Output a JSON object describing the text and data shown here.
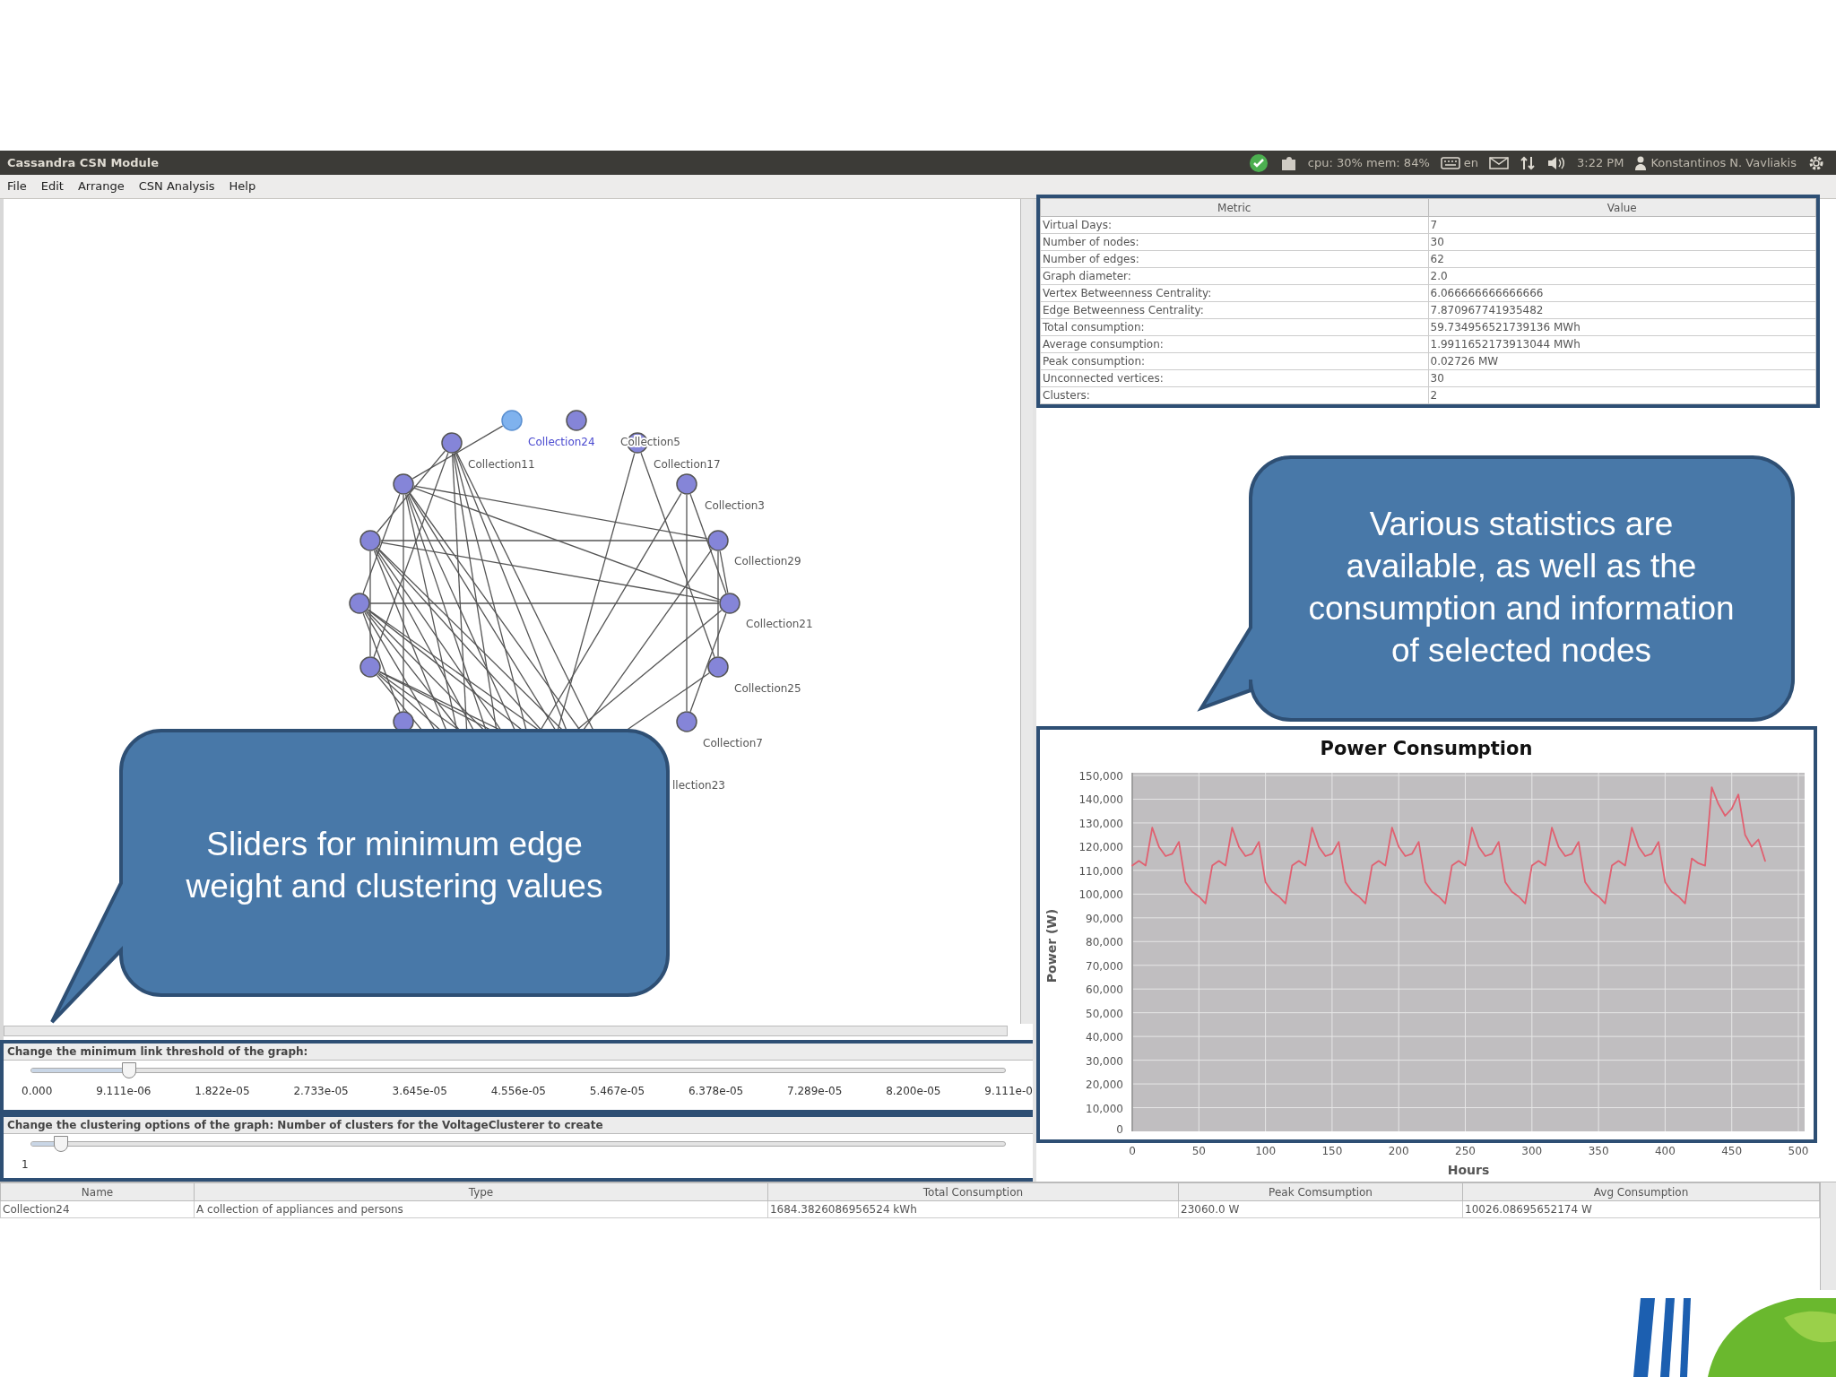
{
  "window": {
    "title": "Cassandra CSN Module"
  },
  "status": {
    "system": "cpu: 30% mem: 84%",
    "keyboard": "en",
    "time": "3:22 PM",
    "user": "Konstantinos N. Vavliakis"
  },
  "menu": [
    "File",
    "Edit",
    "Arrange",
    "CSN Analysis",
    "Help"
  ],
  "graph": {
    "nodes": [
      {
        "label": "Collection24",
        "selected": true
      },
      {
        "label": "Collection5",
        "selected": false
      },
      {
        "label": "Collection11",
        "selected": false
      },
      {
        "label": "Collection17",
        "selected": false
      },
      {
        "selected": false
      },
      {
        "label": "Collection3",
        "selected": false
      },
      {
        "selected": false
      },
      {
        "label": "Collection29",
        "selected": false
      },
      {
        "selected": false
      },
      {
        "label": "Collection21",
        "selected": false
      },
      {
        "selected": false
      },
      {
        "label": "Collection25",
        "selected": false
      },
      {
        "selected": false
      },
      {
        "label": "Collection7",
        "selected": false
      }
    ],
    "cut_labels": [
      "llection23"
    ]
  },
  "sliders": [
    {
      "label": "Change the minimum link threshold of the graph:",
      "level": 0.1,
      "ticks": [
        "0.000",
        "9.111e-06",
        "1.822e-05",
        "2.733e-05",
        "3.645e-05",
        "4.556e-05",
        "5.467e-05",
        "6.378e-05",
        "7.289e-05",
        "8.200e-05",
        "9.111e-0"
      ]
    },
    {
      "label": "Change the clustering options of the graph: Number of clusters for the VoltageClusterer to create",
      "level": 0.03,
      "ticks": [
        "1"
      ]
    }
  ],
  "stats": {
    "columns": [
      "Metric",
      "Value"
    ],
    "rows": [
      [
        "Virtual Days:",
        "7"
      ],
      [
        "Number of nodes:",
        "30"
      ],
      [
        "Number of edges:",
        "62"
      ],
      [
        "Graph diameter:",
        "2.0"
      ],
      [
        "Vertex Betweenness Centrality:",
        "6.066666666666666"
      ],
      [
        "Edge Betweenness Centrality:",
        "7.870967741935482"
      ],
      [
        "Total consumption:",
        "59.734956521739136 MWh"
      ],
      [
        "Average consumption:",
        "1.9911652173913044 MWh"
      ],
      [
        "Peak consumption:",
        "0.02726 MW"
      ],
      [
        "Unconnected vertices:",
        "30"
      ],
      [
        "Clusters:",
        "2"
      ]
    ]
  },
  "chart_data": {
    "type": "line",
    "title": "Power Consumption",
    "xlabel": "Hours",
    "ylabel": "Power (W)",
    "x": [
      0,
      5,
      10,
      15,
      20,
      25,
      30,
      35,
      40,
      45,
      50,
      55,
      60,
      65,
      70,
      75,
      80,
      85,
      90,
      95,
      100,
      105,
      110,
      115,
      120,
      125,
      130,
      135,
      140,
      145,
      150,
      155,
      160,
      165,
      170,
      175,
      180,
      185,
      190,
      195,
      200,
      205,
      210,
      215,
      220,
      225,
      230,
      235,
      240,
      245,
      250,
      255,
      260,
      265,
      270,
      275,
      280,
      285,
      290,
      295,
      300,
      305,
      310,
      315,
      320,
      325,
      330,
      335,
      340,
      345,
      350,
      355,
      360,
      365,
      370,
      375,
      380,
      385,
      390,
      395,
      400,
      405,
      410,
      415,
      420,
      425,
      430,
      435,
      440,
      445,
      450,
      455,
      460,
      465,
      470,
      475
    ],
    "grid": true,
    "series": [
      {
        "color": "#e06070",
        "values": [
          112000,
          114000,
          112000,
          128000,
          120000,
          116000,
          117000,
          122000,
          105000,
          101000,
          99000,
          96000,
          112000,
          114000,
          112000,
          128000,
          120000,
          116000,
          117000,
          122000,
          105000,
          101000,
          99000,
          96000,
          112000,
          114000,
          112000,
          128000,
          120000,
          116000,
          117000,
          122000,
          105000,
          101000,
          99000,
          96000,
          112000,
          114000,
          112000,
          128000,
          120000,
          116000,
          117000,
          122000,
          105000,
          101000,
          99000,
          96000,
          112000,
          114000,
          112000,
          128000,
          120000,
          116000,
          117000,
          122000,
          105000,
          101000,
          99000,
          96000,
          112000,
          114000,
          112000,
          128000,
          120000,
          116000,
          117000,
          122000,
          105000,
          101000,
          99000,
          96000,
          112000,
          114000,
          112000,
          128000,
          120000,
          116000,
          117000,
          122000,
          105000,
          101000,
          99000,
          96000,
          115000,
          113000,
          112000,
          145000,
          138000,
          133000,
          136000,
          142000,
          125000,
          120000,
          123000,
          114000
        ]
      }
    ],
    "xlim": [
      0,
      500
    ],
    "ylim": [
      0,
      150000
    ],
    "xticks": [
      0,
      50,
      100,
      150,
      200,
      250,
      300,
      350,
      400,
      450,
      500
    ],
    "yticks": [
      {
        "value": 0,
        "label": "0"
      },
      {
        "value": 10000,
        "label": "10,000"
      },
      {
        "value": 20000,
        "label": "20,000"
      },
      {
        "value": 30000,
        "label": "30,000"
      },
      {
        "value": 40000,
        "label": "40,000"
      },
      {
        "value": 50000,
        "label": "50,000"
      },
      {
        "value": 60000,
        "label": "60,000"
      },
      {
        "value": 70000,
        "label": "70,000"
      },
      {
        "value": 80000,
        "label": "80,000"
      },
      {
        "value": 90000,
        "label": "90,000"
      },
      {
        "value": 100000,
        "label": "100,000"
      },
      {
        "value": 110000,
        "label": "110,000"
      },
      {
        "value": 120000,
        "label": "120,000"
      },
      {
        "value": 130000,
        "label": "130,000"
      },
      {
        "value": 140000,
        "label": "140,000"
      },
      {
        "value": 150000,
        "label": "150,000"
      }
    ]
  },
  "details": {
    "columns": [
      "Name",
      "Type",
      "Total Consumption",
      "Peak Comsumption",
      "Avg Consumption"
    ],
    "rows": [
      [
        "Collection24",
        "A collection of appliances and persons",
        "1684.3826086956524 kWh",
        "23060.0 W",
        "10026.08695652174 W"
      ]
    ]
  },
  "callouts": [
    {
      "text": "Various statistics are available, as well as the consumption and information of selected nodes"
    },
    {
      "text": "Sliders for minimum edge weight and clustering values"
    }
  ]
}
